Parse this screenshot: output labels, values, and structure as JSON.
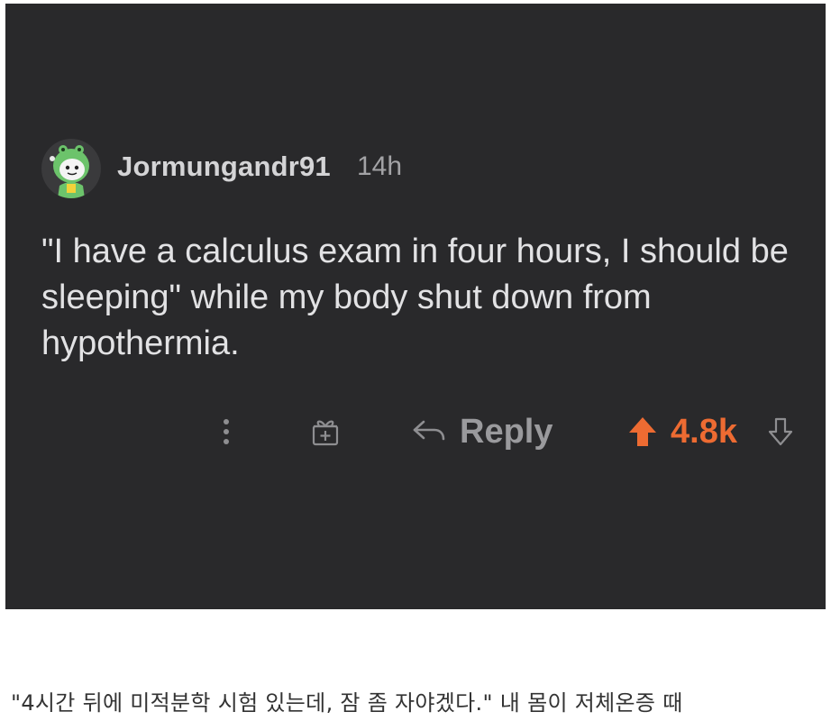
{
  "comment": {
    "username": "Jormungandr91",
    "timestamp": "14h",
    "body": "\"I have a calculus exam in four hours, I should be sleeping\" while my body shut down from hypothermia.",
    "avatar_icon": "snoo-dinosaur-avatar-icon"
  },
  "actions": {
    "more_icon": "vertical-ellipsis-icon",
    "award_icon": "gift-award-icon",
    "reply_icon": "reply-arrow-icon",
    "reply_label": "Reply",
    "upvote_icon": "upvote-arrow-icon",
    "score": "4.8k",
    "downvote_icon": "downvote-arrow-icon"
  },
  "caption": {
    "text": "\"4시간 뒤에 미적분학 시험 있는데, 잠 좀 자야겠다.\" 내 몸이 저체온증 때"
  },
  "colors": {
    "card_background": "#29292b",
    "page_background": "#ffffff",
    "upvoted_accent": "#ed6b32",
    "muted_text": "#9a9a9d"
  }
}
